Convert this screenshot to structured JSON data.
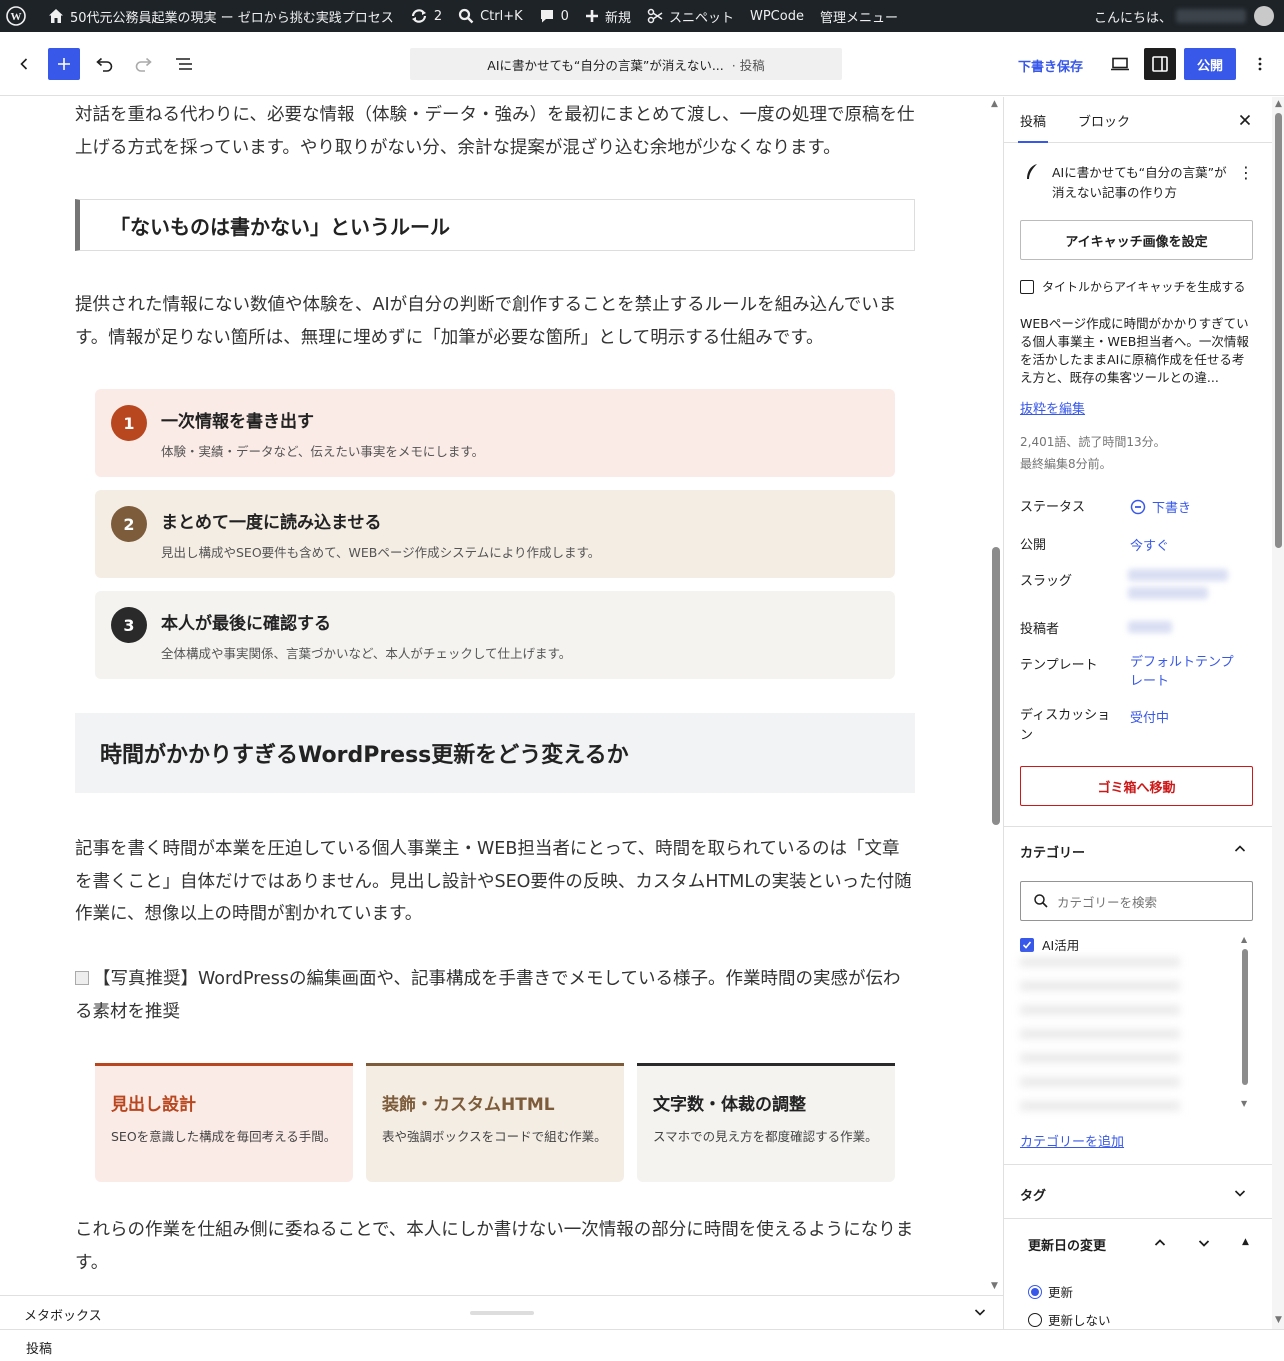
{
  "admin_bar": {
    "site_title": "50代元公務員起業の現実 ー ゼロから挑む実践プロセス",
    "updates_count": "2",
    "search_shortcut": "Ctrl+K",
    "comments_count": "0",
    "new_label": "新規",
    "snippets_label": "スニペット",
    "wpcode_label": "WPCode",
    "admin_menu_label": "管理メニュー",
    "greeting": "こんにちは、"
  },
  "editor_header": {
    "doc_title": "AIに書かせても“自分の言葉”が消えない...",
    "doc_type": "· 投稿",
    "save_draft_label": "下書き保存",
    "publish_label": "公開"
  },
  "content": {
    "para_top": "対話を重ねる代わりに、必要な情報（体験・データ・強み）を最初にまとめて渡し、一度の処理で原稿を仕上げる方式を採っています。やり取りがない分、余計な提案が混ざり込む余地が少なくなります。",
    "h3": "「ないものは書かない」というルール",
    "para_rule": "提供された情報にない数値や体験を、AIが自分の判断で創作することを禁止するルールを組み込んでいます。情報が足りない箇所は、無理に埋めずに「加筆が必要な箇所」として明示する仕組みです。",
    "steps": [
      {
        "num": "1",
        "title": "一次情報を書き出す",
        "desc": "体験・実績・データなど、伝えたい事実をメモにします。"
      },
      {
        "num": "2",
        "title": "まとめて一度に読み込ませる",
        "desc": "見出し構成やSEO要件も含めて、WEBページ作成システムにより作成します。"
      },
      {
        "num": "3",
        "title": "本人が最後に確認する",
        "desc": "全体構成や事実関係、言葉づかいなど、本人がチェックして仕上げます。"
      }
    ],
    "h2": "時間がかかりすぎるWordPress更新をどう変えるか",
    "para_time": "記事を書く時間が本業を圧迫している個人事業主・WEB担当者にとって、時間を取られているのは「文章を書くこと」自体だけではありません。見出し設計やSEO要件の反映、カスタムHTMLの実装といった付随作業に、想像以上の時間が割かれています。",
    "image_alt": "【写真推奨】WordPressの編集画面や、記事構成を手書きでメモしている様子。作業時間の実感が伝わる素材を推奨",
    "cards": [
      {
        "title": "見出し設計",
        "desc": "SEOを意識した構成を毎回考える手間。"
      },
      {
        "title": "装飾・カスタムHTML",
        "desc": "表や強調ボックスをコードで組む作業。"
      },
      {
        "title": "文字数・体裁の調整",
        "desc": "スマホでの見え方を都度確認する作業。"
      }
    ],
    "para_end": "これらの作業を仕組み側に委ねることで、本人にしか書けない一次情報の部分に時間を使えるようになります。"
  },
  "colors": {
    "accent": "#3858e9",
    "step1_bg": "#fbebe6",
    "step1_num": "#b8471f",
    "step2_bg": "#f4ede4",
    "step2_num": "#7d5c3b",
    "step3_bg": "#f4f3f0",
    "step3_num": "#2a2a2a",
    "card1_border": "#b8471f",
    "card1_title": "#b8471f",
    "card2_border": "#7d5c3b",
    "card2_title": "#7d5c3b",
    "card3_border": "#2a2a2a",
    "card3_title": "#222222"
  },
  "metabox": {
    "label": "メタボックス"
  },
  "footer": {
    "breadcrumb": "投稿"
  },
  "sidebar": {
    "tab_post": "投稿",
    "tab_block": "ブロック",
    "post_title": "AIに書かせても“自分の言葉”が消えない記事の作り方",
    "featured_image_button": "アイキャッチ画像を設定",
    "generate_from_title": "タイトルからアイキャッチを生成する",
    "excerpt": "WEBページ作成に時間がかかりすぎている個人事業主・WEB担当者へ。一次情報を活かしたままAIに原稿作成を任せる考え方と、既存の集客ツールとの違...",
    "edit_excerpt": "抜粋を編集",
    "word_count": "2,401語、読了時間13分。",
    "last_edited": "最終編集8分前。",
    "status_label": "ステータス",
    "status_value": "下書き",
    "publish_label": "公開",
    "publish_value": "今すぐ",
    "slug_label": "スラッグ",
    "author_label": "投稿者",
    "template_label": "テンプレート",
    "template_value": "デフォルトテンプレート",
    "discussion_label": "ディスカッション",
    "discussion_value": "受付中",
    "trash_button": "ゴミ箱へ移動",
    "category_panel": "カテゴリー",
    "category_search_placeholder": "カテゴリーを検索",
    "category_checked": "AI活用",
    "add_category": "カテゴリーを追加",
    "tag_panel": "タグ",
    "update_date_panel": "更新日の変更",
    "radio_update": "更新",
    "radio_no_update": "更新しない"
  }
}
